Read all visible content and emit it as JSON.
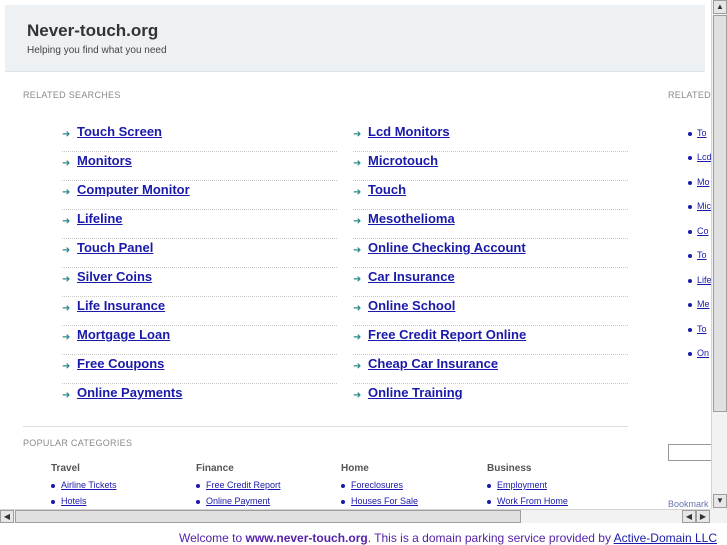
{
  "header": {
    "title": "Never-touch.org",
    "tagline": "Helping you find what you need"
  },
  "related_searches": {
    "label": "RELATED SEARCHES",
    "left": [
      "Touch Screen",
      "Monitors",
      "Computer Monitor",
      "Lifeline",
      "Touch Panel",
      "Silver Coins",
      "Life Insurance",
      "Mortgage Loan",
      "Free Coupons",
      "Online Payments"
    ],
    "right": [
      "Lcd Monitors",
      "Microtouch",
      "Touch",
      "Mesothelioma",
      "Online Checking Account",
      "Car Insurance",
      "Online School",
      "Free Credit Report Online",
      "Cheap Car Insurance",
      "Online Training"
    ]
  },
  "right_panel": {
    "label": "RELATED",
    "items": [
      "To",
      "Lcd",
      "Mo",
      "Mic",
      "Co",
      "To",
      "Life",
      "Me",
      "To",
      "On"
    ],
    "bookmark": "Bookmark"
  },
  "popular_categories": {
    "label": "POPULAR CATEGORIES",
    "columns": [
      {
        "heading": "Travel",
        "links": [
          "Airline Tickets",
          "Hotels"
        ]
      },
      {
        "heading": "Finance",
        "links": [
          "Free Credit Report",
          "Online Payment"
        ]
      },
      {
        "heading": "Home",
        "links": [
          "Foreclosures",
          "Houses For Sale"
        ]
      },
      {
        "heading": "Business",
        "links": [
          "Employment",
          "Work From Home"
        ]
      }
    ]
  },
  "footer": {
    "prefix": "Welcome to ",
    "domain": "www.never-touch.org",
    "middle": ". This is a domain parking service provided by ",
    "provider": "Active-Domain LLC"
  },
  "icons": {
    "arrow": "arrow-right-icon",
    "bullet": "bullet-dot-icon"
  },
  "colors": {
    "link": "#1a1aaa",
    "arrow": "#2b8a8a",
    "header_bg": "#eef1f4",
    "footer_text": "#5522aa"
  }
}
